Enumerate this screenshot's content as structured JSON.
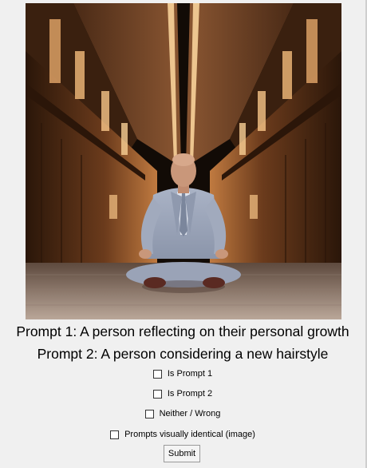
{
  "image": {
    "subject": "seated-meditating-man-in-grey-suit-hallway"
  },
  "prompts": {
    "prompt1": "Prompt 1: A person reflecting on their personal growth",
    "prompt2": "Prompt 2: A person considering a new hairstyle"
  },
  "options": {
    "is_prompt_1": "Is Prompt 1",
    "is_prompt_2": "Is Prompt 2",
    "neither": "Neither / Wrong",
    "identical": "Prompts visually identical (image)"
  },
  "submit_label": "Submit",
  "colors": {
    "background": "#f0f0f0",
    "suit": "#9aa4b8",
    "wood": "#8a5a36"
  }
}
